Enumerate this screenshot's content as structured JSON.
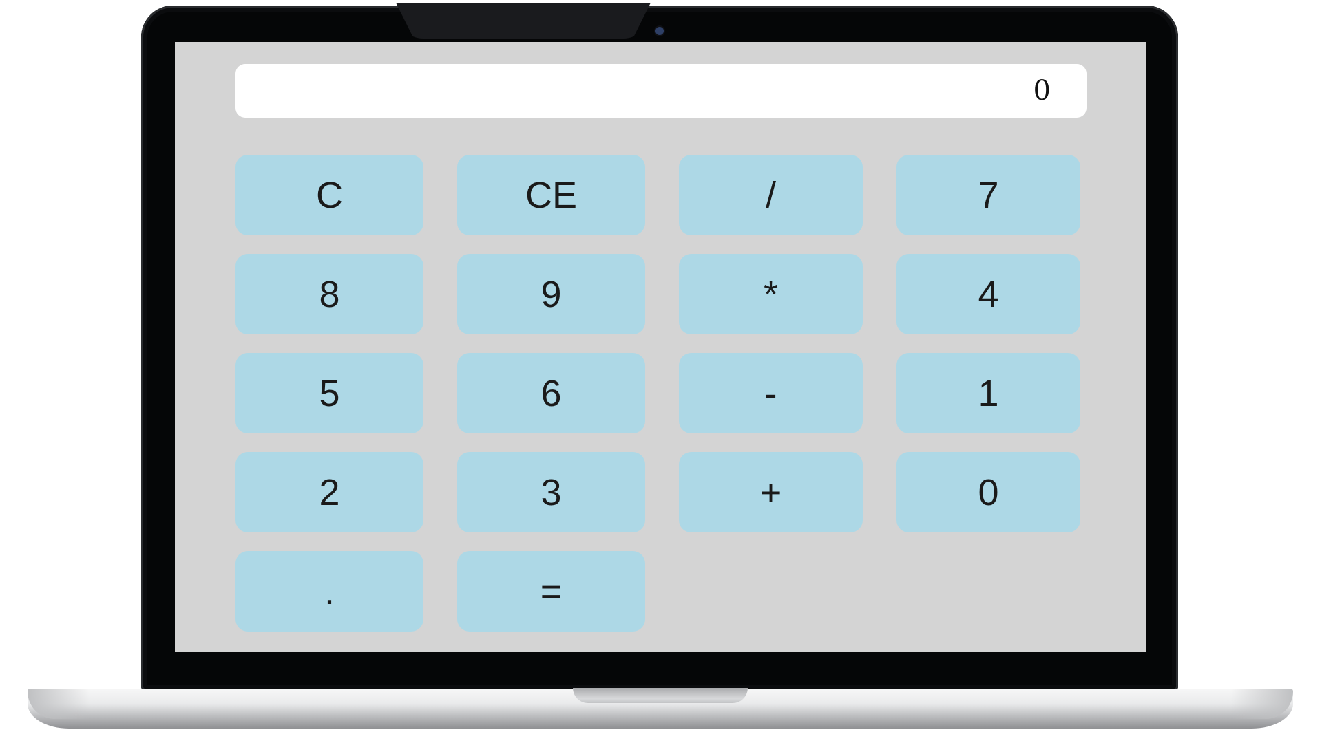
{
  "calculator": {
    "display_value": "0",
    "keys": [
      "C",
      "CE",
      "/",
      "7",
      "8",
      "9",
      "*",
      "4",
      "5",
      "6",
      "-",
      "1",
      "2",
      "3",
      "+",
      "0",
      ".",
      "="
    ]
  },
  "colors": {
    "screen_background": "#d4d4d4",
    "key_background": "#add8e6",
    "display_background": "#ffffff",
    "bezel": "#050607"
  }
}
